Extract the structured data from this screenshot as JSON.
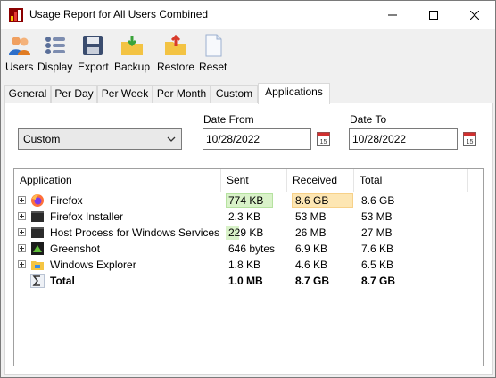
{
  "window": {
    "title": "Usage Report for All Users Combined"
  },
  "toolbar": {
    "users": "Users",
    "display": "Display",
    "export": "Export",
    "backup": "Backup",
    "restore": "Restore",
    "reset": "Reset"
  },
  "tabs": [
    "General",
    "Per Day",
    "Per Week",
    "Per Month",
    "Custom",
    "Applications"
  ],
  "filter": {
    "range_value": "Custom",
    "date_from_label": "Date From",
    "date_from": "10/28/2022",
    "date_to_label": "Date To",
    "date_to": "10/28/2022"
  },
  "table": {
    "headers": [
      "Application",
      "Sent",
      "Received",
      "Total"
    ],
    "rows": [
      {
        "name": "Firefox",
        "sent": "774 KB",
        "received": "8.6 GB",
        "total": "8.6 GB",
        "icon": "firefox-icon",
        "sent_fraction": 0.75,
        "received_fraction": 0.99
      },
      {
        "name": "Firefox Installer",
        "sent": "2.3 KB",
        "received": "53 MB",
        "total": "53 MB",
        "icon": "installer-icon"
      },
      {
        "name": "Host Process for Windows Services",
        "sent": "229 KB",
        "received": "26 MB",
        "total": "27 MB",
        "icon": "host-process-icon",
        "sent_fraction": 0.22
      },
      {
        "name": "Greenshot",
        "sent": "646 bytes",
        "received": "6.9 KB",
        "total": "7.6 KB",
        "icon": "greenshot-icon"
      },
      {
        "name": "Windows Explorer",
        "sent": "1.8 KB",
        "received": "4.6 KB",
        "total": "6.5 KB",
        "icon": "explorer-icon"
      }
    ],
    "total_row": {
      "name": "Total",
      "sent": "1.0 MB",
      "received": "8.7 GB",
      "total": "8.7 GB",
      "icon": "sigma-icon"
    }
  },
  "colors": {
    "sent_bar": "#d9f2c9",
    "received_bar": "#fde6b3",
    "tab_border": "#d9d9d9"
  }
}
